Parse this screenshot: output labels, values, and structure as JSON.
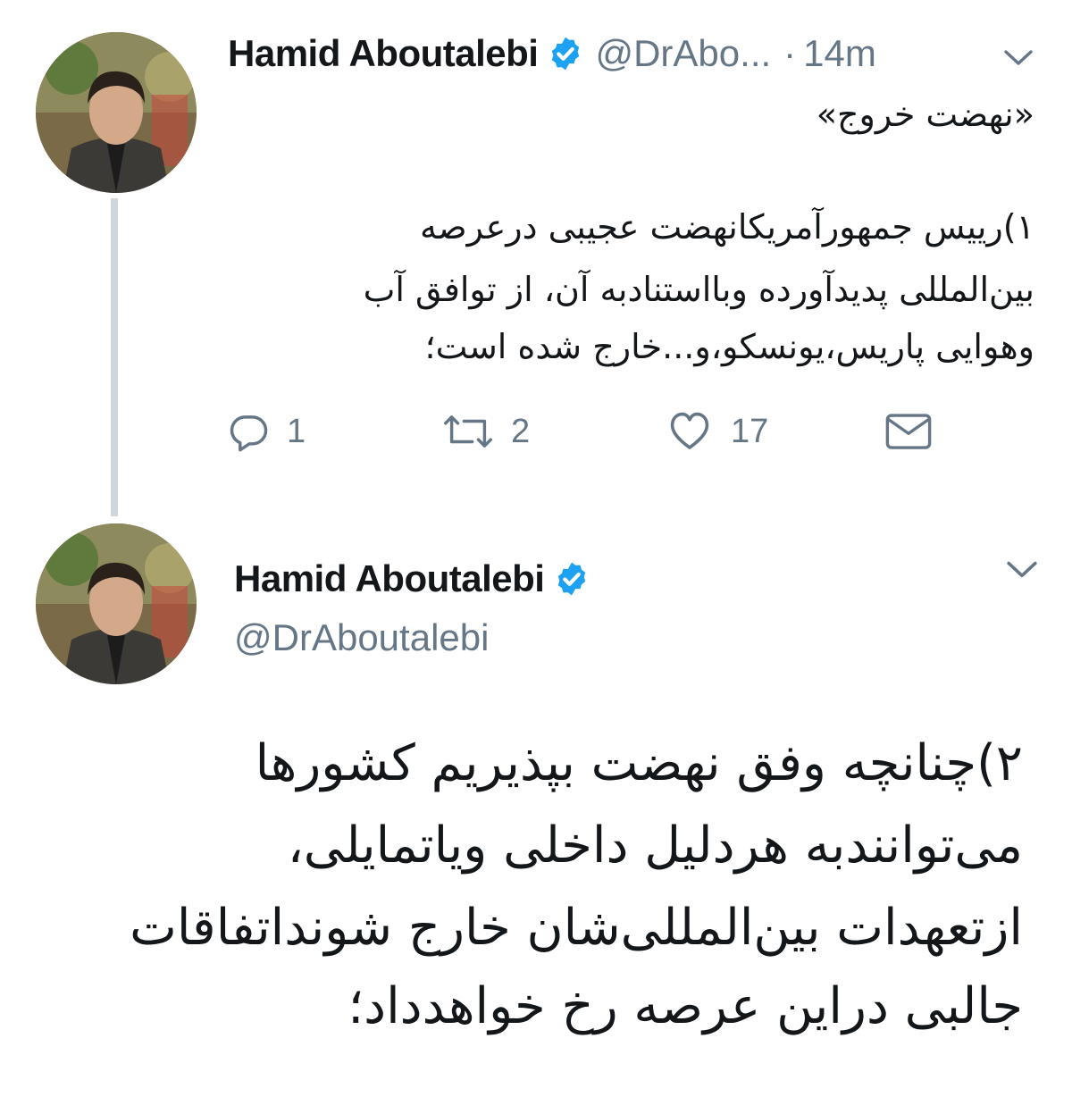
{
  "tweet1": {
    "author_name": "Hamid Aboutalebi",
    "handle": "@DrAbo...",
    "separator": "·",
    "timestamp": "14m",
    "text_title": "«نهضت خروج»",
    "text_lines": [
      "۱)رییس جمهورآمریکانهضت عجیبی درعرصه",
      "بین‌المللی پدیدآورده وبااستنادبه آن، از توافق آب",
      "وهوایی پاریس،یونسکو،و...خارج شده است؛"
    ],
    "actions": {
      "reply_icon": "reply-icon",
      "reply_count": "1",
      "retweet_icon": "retweet-icon",
      "retweet_count": "2",
      "like_icon": "heart-icon",
      "like_count": "17",
      "dm_icon": "envelope-icon"
    }
  },
  "tweet2": {
    "author_name": "Hamid Aboutalebi",
    "handle": "@DrAboutalebi",
    "text_lines": [
      "۲)چنانچه وفق نهضت بپذیریم کشورها",
      "می‌توانندبه هردلیل داخلی ویاتمایلی،",
      "ازتعهدات بین‌المللی‌شان خارج شونداتفاقات",
      "جالبی دراین عرصه رخ خواهدداد؛"
    ]
  },
  "icons": {
    "verified": "verified-badge-icon",
    "chevron": "chevron-down-icon"
  },
  "colors": {
    "text": "#14171a",
    "secondary": "#657786",
    "verified": "#1da1f2",
    "thread_line": "#cdd6dd",
    "icon": "#657786"
  }
}
